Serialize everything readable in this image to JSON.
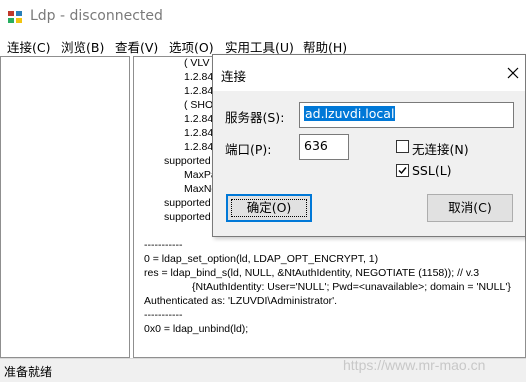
{
  "window": {
    "title": "Ldp - disconnected"
  },
  "menu": [
    "连接(C)",
    "浏览(B)",
    "查看(V)",
    "选项(O)",
    "实用工具(U)",
    "帮助(H)"
  ],
  "output_lines": [
    "( VLV",
    "1.2.84",
    "1.2.84",
    "( SHO",
    "1.2.84",
    "1.2.84",
    "1.2.84",
    "supported",
    "MaxPa",
    "MaxNo",
    "supported",
    "supported",
    "-----------",
    "0 = ldap_set_option(ld, LDAP_OPT_ENCRYPT, 1)",
    "res = ldap_bind_s(ld, NULL, &NtAuthIdentity, NEGOTIATE (1158)); // v.3",
    "{NtAuthIdentity: User='NULL'; Pwd=<unavailable>; domain = 'NULL'}",
    "Authenticated as: 'LZUVDI\\Administrator'.",
    "-----------",
    "0x0 = ldap_unbind(ld);"
  ],
  "status": "准备就绪",
  "watermark": "https://www.mr-mao.cn",
  "dialog": {
    "title": "连接",
    "server_label": "服务器(S):",
    "server_value": "ad.lzuvdi.local",
    "port_label": "端口(P):",
    "port_value": "636",
    "connectionless_label": "无连接(N)",
    "connectionless_checked": false,
    "ssl_label": "SSL(L)",
    "ssl_checked": true,
    "ok_label": "确定(O)",
    "cancel_label": "取消(C)"
  },
  "colors": {
    "accent": "#0078d7",
    "dialog_bg": "#f0f0f0"
  }
}
